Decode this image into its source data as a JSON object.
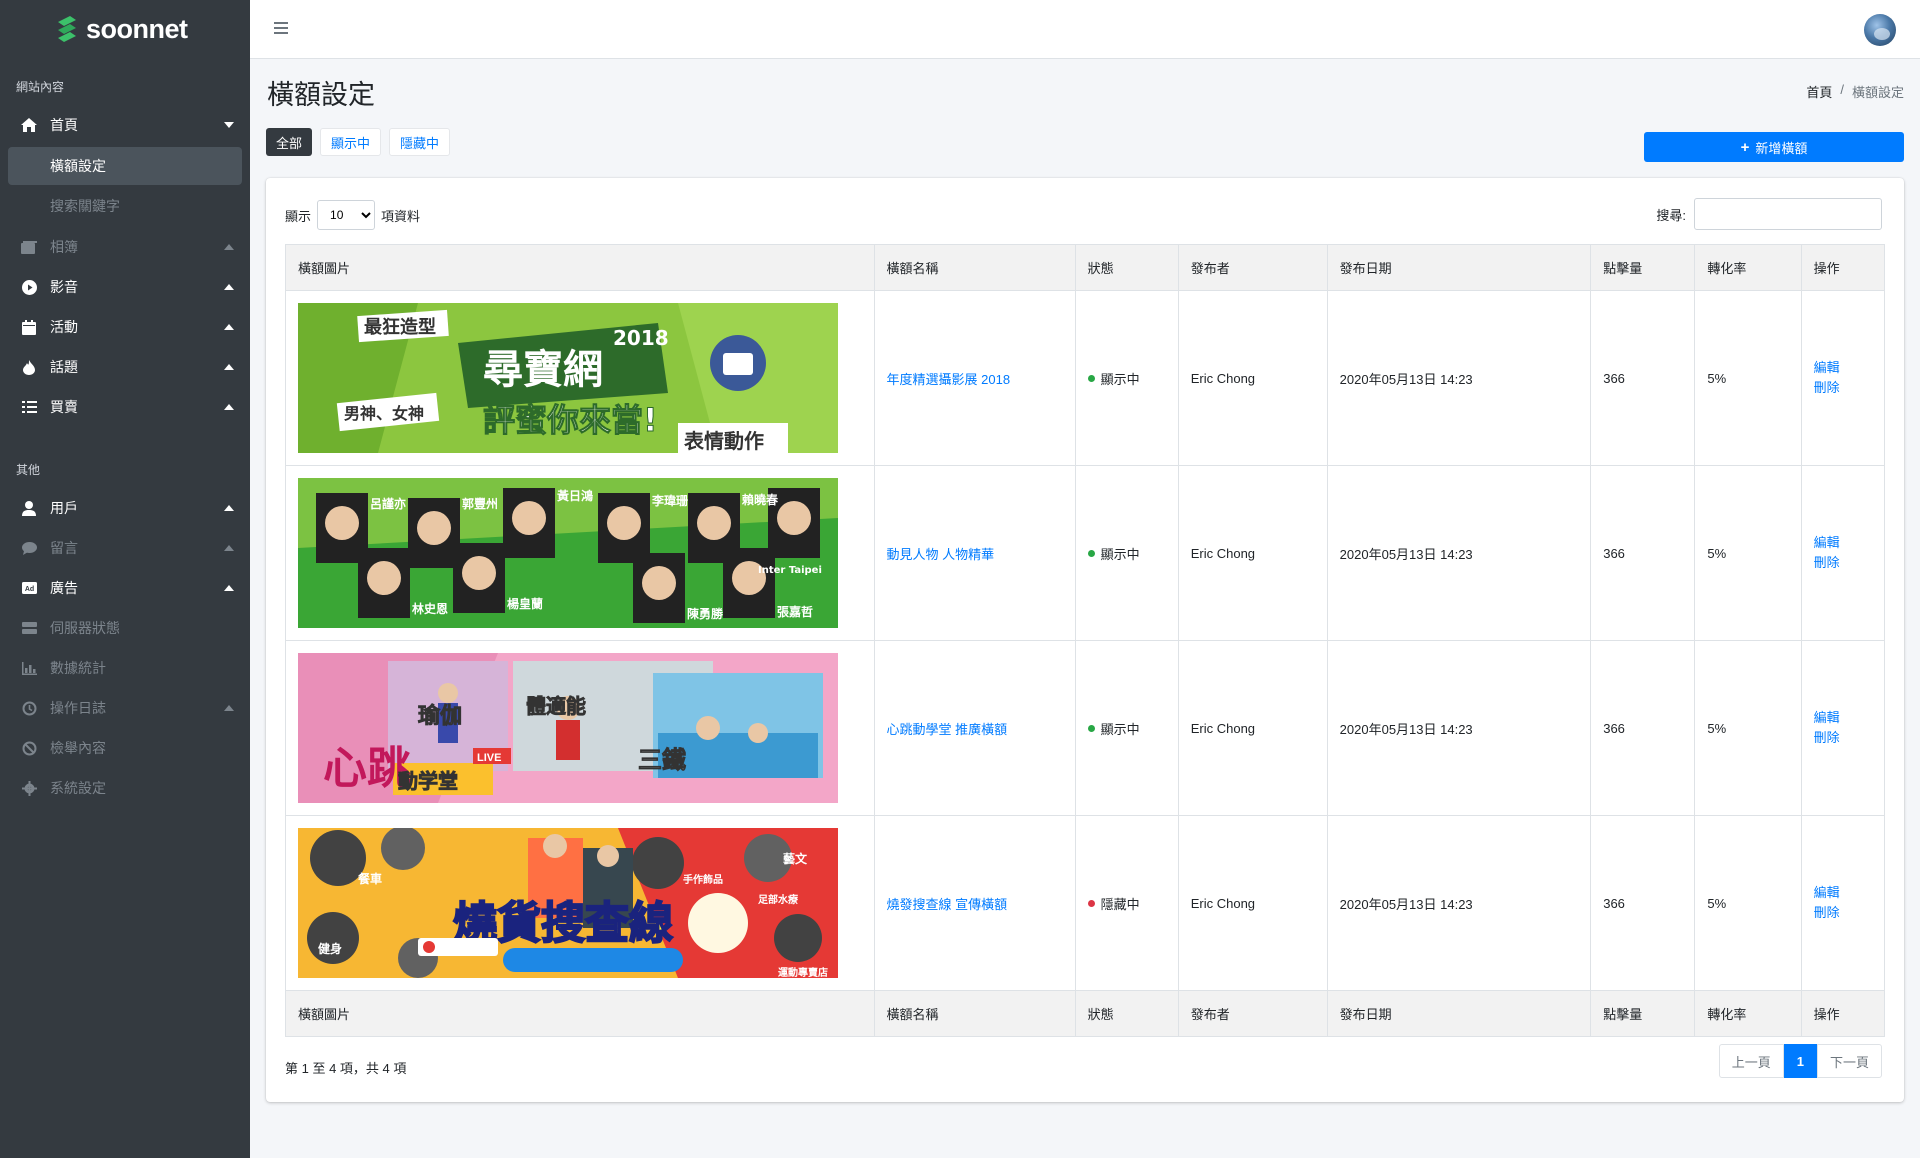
{
  "brand": {
    "name": "soonnet",
    "accent": "#3cc16a"
  },
  "sidebar": {
    "section_content": "網站內容",
    "section_other": "其他",
    "home": {
      "label": "首頁",
      "icon": "home-icon"
    },
    "home_children": [
      {
        "label": "橫額設定",
        "active": true
      },
      {
        "label": "搜索關鍵字",
        "active": false
      }
    ],
    "items": [
      {
        "label": "相簿",
        "icon": "photo-icon",
        "dim": true
      },
      {
        "label": "影音",
        "icon": "play-circle-icon",
        "dim": false
      },
      {
        "label": "活動",
        "icon": "calendar-icon",
        "dim": false
      },
      {
        "label": "話題",
        "icon": "fire-icon",
        "dim": false
      },
      {
        "label": "買賣",
        "icon": "list-icon",
        "dim": false
      }
    ],
    "other_items": [
      {
        "label": "用戶",
        "icon": "user-icon",
        "dim": false,
        "chev": true
      },
      {
        "label": "留言",
        "icon": "comment-icon",
        "dim": true,
        "chev": true
      },
      {
        "label": "廣告",
        "icon": "ad-icon",
        "dim": false,
        "chev": true
      },
      {
        "label": "伺服器狀態",
        "icon": "server-icon",
        "dim": true,
        "chev": false
      },
      {
        "label": "數據統計",
        "icon": "chart-icon",
        "dim": true,
        "chev": false
      },
      {
        "label": "操作日誌",
        "icon": "history-icon",
        "dim": true,
        "chev": true
      },
      {
        "label": "檢舉內容",
        "icon": "ban-icon",
        "dim": true,
        "chev": false
      },
      {
        "label": "系統設定",
        "icon": "gear-icon",
        "dim": true,
        "chev": false
      }
    ]
  },
  "page": {
    "title": "橫額設定",
    "breadcrumb": {
      "home": "首頁",
      "separator": "/",
      "current": "橫額設定"
    },
    "filters": [
      "全部",
      "顯示中",
      "隱藏中"
    ],
    "add_button": "新增橫額"
  },
  "table_controls": {
    "show_label": "顯示",
    "page_size": "10",
    "entries_label": "項資料",
    "search_label": "搜尋:"
  },
  "columns": [
    "橫額圖片",
    "橫額名稱",
    "狀態",
    "發布者",
    "發布日期",
    "點擊量",
    "轉化率",
    "操作"
  ],
  "rows": [
    {
      "name": "年度精選攝影展 2018",
      "status": "顯示中",
      "status_on": true,
      "publisher": "Eric Chong",
      "date": "2020年05月13日 14:23",
      "clicks": "366",
      "rate": "5%",
      "edit": "編輯",
      "delete": "刪除",
      "banner_text": [
        "最狂造型",
        "尋寶網",
        "2018",
        "評蜜你來當!",
        "男神、女神",
        "表情動作"
      ]
    },
    {
      "name": "動見人物 人物精華",
      "status": "顯示中",
      "status_on": true,
      "publisher": "Eric Chong",
      "date": "2020年05月13日 14:23",
      "clicks": "366",
      "rate": "5%",
      "edit": "編輯",
      "delete": "刪除",
      "banner_text": [
        "呂謹亦",
        "郭豐州",
        "黃日鴻",
        "李瑋珊",
        "賴曉春",
        "林史恩",
        "楊皇蘭",
        "陳勇勝",
        "張嘉哲",
        "Inter Taipei"
      ]
    },
    {
      "name": "心跳動學堂 推廣橫額",
      "status": "顯示中",
      "status_on": true,
      "publisher": "Eric Chong",
      "date": "2020年05月13日 14:23",
      "clicks": "366",
      "rate": "5%",
      "edit": "編輯",
      "delete": "刪除",
      "banner_text": [
        "心跳",
        "動学堂",
        "LIVE",
        "瑜伽",
        "體適能",
        "三鐵"
      ]
    },
    {
      "name": "燒發搜查線 宣傳橫額",
      "status": "隱藏中",
      "status_on": false,
      "publisher": "Eric Chong",
      "date": "2020年05月13日 14:23",
      "clicks": "366",
      "rate": "5%",
      "edit": "編輯",
      "delete": "刪除",
      "banner_text": [
        "燒貨搜查線",
        "餐車",
        "藝文",
        "手作飾品",
        "足部水療",
        "健身",
        "運動專賣店"
      ]
    }
  ],
  "footer": {
    "info": "第 1 至 4 項，共 4 項",
    "prev": "上一頁",
    "current_page": "1",
    "next": "下一頁"
  }
}
